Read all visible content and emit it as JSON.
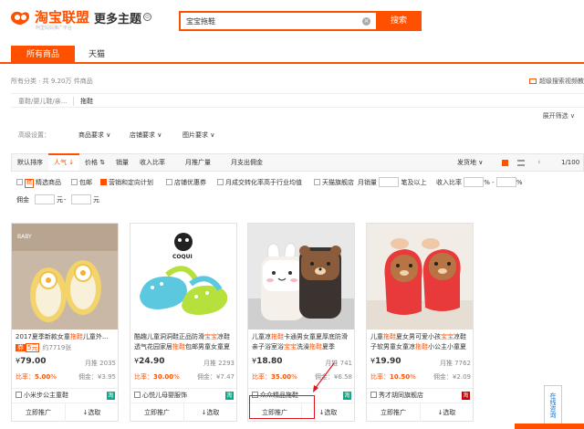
{
  "header": {
    "logo_text": "淘宝联盟",
    "logo_sub": "阿里妈妈推广平台",
    "theme_title": "更多主题",
    "theme_icon": "circle-info-icon",
    "search_value": "宝宝拖鞋",
    "search_button": "搜索",
    "clear_icon": "clear-icon"
  },
  "tabs": [
    {
      "label": "所有商品",
      "active": true
    },
    {
      "label": "天猫",
      "active": false
    }
  ],
  "subbar": {
    "count_text": "所有分类 · 共 9.20万 件商品",
    "right_link": "超级搜索视频教"
  },
  "breadcrumb": {
    "path": "童鞋/婴儿鞋/亲...",
    "keyword": "拖鞋"
  },
  "expand_label": "展开筛选",
  "advanced": {
    "label": "高级设置：",
    "dropdowns": [
      "商品要求",
      "店铺要求",
      "图片要求"
    ]
  },
  "sortbar": {
    "items": [
      "默认排序",
      "人气",
      "价格",
      "销量",
      "收入比率",
      "月推广量",
      "月支出佣金"
    ],
    "active_index": 1,
    "ship_from": "发货地",
    "pager": "1/100"
  },
  "filters": {
    "items": [
      {
        "label": "精选商品",
        "checked": false,
        "tag": "精"
      },
      {
        "label": "包邮",
        "checked": false
      },
      {
        "label": "营销和定向计划",
        "checked": true
      },
      {
        "label": "店铺优惠券",
        "checked": false
      },
      {
        "label": "月成交转化率高于行业均值",
        "checked": false
      },
      {
        "label": "天猫旗舰店",
        "checked": false
      }
    ],
    "monthly_sales_label": "月销量",
    "monthly_sales_suffix": "笔及以上",
    "income_label": "收入比率",
    "percent": "%",
    "dash": "-",
    "commission_label": "佣金",
    "yuan": "元",
    "dash2": "-",
    "yuan2": "元"
  },
  "products": [
    {
      "title_pre": "2017夏季新款女童",
      "title_hl": "拖鞋",
      "title_post": "儿童外...",
      "meta": "约7719张",
      "price": "79.00",
      "sales_label": "月推",
      "sales": "2035",
      "rate": "5.00",
      "commission": "3.95",
      "shop": "小米步公主童鞋",
      "badge": "淘"
    },
    {
      "title_pre": "酷趣儿童洞洞鞋正品防滑",
      "title_hl": "宝宝",
      "title_post": "凉鞋透气花园家居",
      "title_hl2": "拖鞋",
      "title_post2": "包邮男童女童夏",
      "meta": "",
      "price": "24.90",
      "sales_label": "月推",
      "sales": "2293",
      "rate": "30.00",
      "commission": "7.47",
      "shop": "心悦儿母婴服饰",
      "badge": "淘"
    },
    {
      "title_pre": "儿童凉",
      "title_hl": "拖鞋",
      "title_post": "卡通男女童夏厚底防滑亲子浴室浴",
      "title_hl2": "宝宝",
      "title_post2": "洗澡",
      "title_hl3": "拖鞋",
      "title_post3": "夏季",
      "meta": "",
      "price": "18.80",
      "sales_label": "月推",
      "sales": "741",
      "rate": "35.00",
      "commission": "6.58",
      "shop": "众众精品拖鞋",
      "badge": "淘"
    },
    {
      "title_pre": "儿童",
      "title_hl": "拖鞋",
      "title_post": "夏女男可爱小孩",
      "title_hl2": "宝宝",
      "title_post2": "凉鞋子软男童女童凉",
      "title_hl3": "拖鞋",
      "title_post3": "小公主小童夏季",
      "meta": "",
      "price": "19.90",
      "sales_label": "月推",
      "sales": "7762",
      "rate": "10.50",
      "commission": "2.09",
      "shop": "秀才胡同旗舰店",
      "badge": "淘"
    }
  ],
  "card_labels": {
    "rate_prefix": "比率：",
    "rate_suffix": "%",
    "commission_prefix": "佣金：¥",
    "currency": "¥",
    "promote": "立即推广",
    "select": "↓选取",
    "coupon_tag": "券",
    "coupon_value": "5元"
  },
  "side_float": "在线咨询",
  "colors": {
    "accent": "#ff5000",
    "annotation": "#e0141e"
  }
}
